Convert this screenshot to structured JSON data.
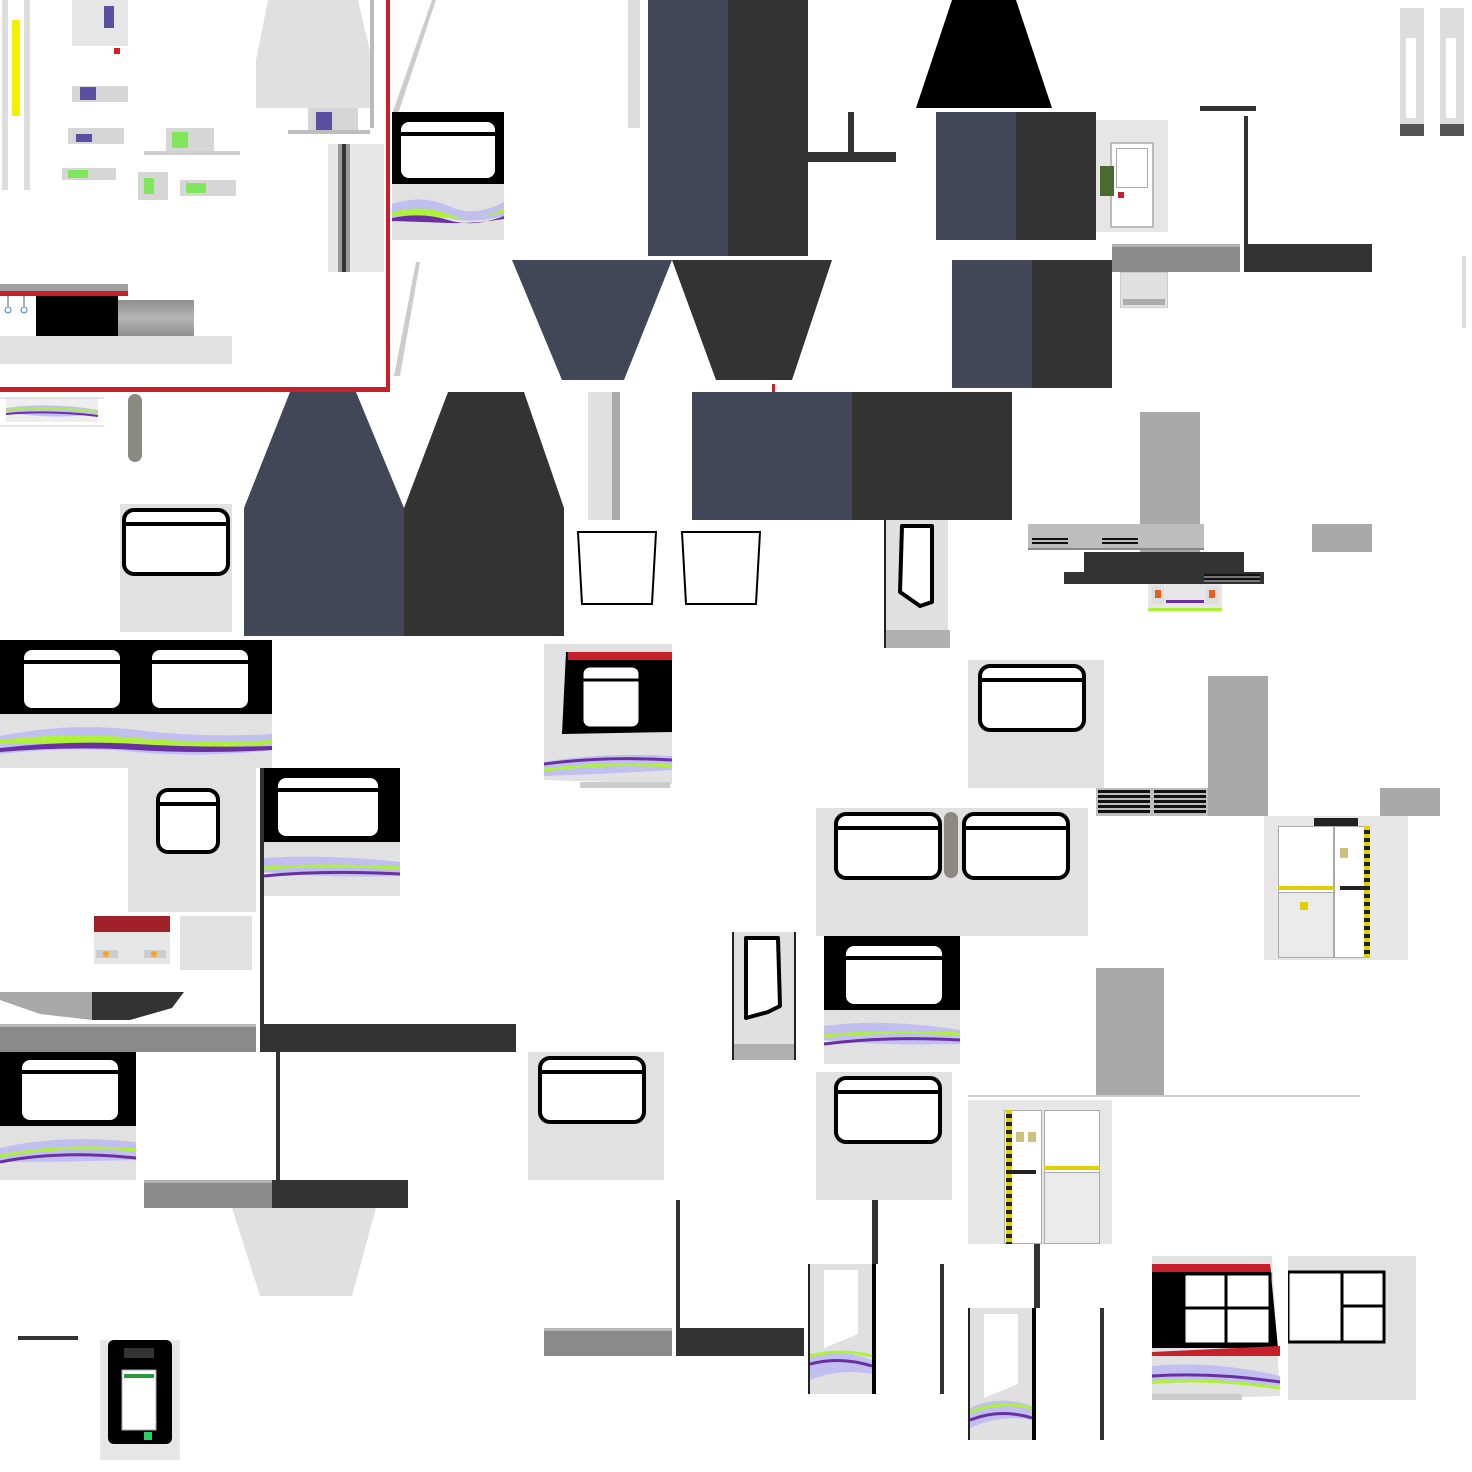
{
  "texture_atlas": {
    "colors": {
      "navy": "#414756",
      "dark": "#333333",
      "light_panel": "#e1e1e1",
      "concrete": "#a9a9a9",
      "accent_red": "#c8202a",
      "livery_purple": "#6a2fa0",
      "livery_lime": "#aef03a",
      "livery_lavender": "#c0bff0",
      "hazard_yellow": "#e0d000"
    },
    "icons": [
      "strap-handle-icon",
      "stop-button-icon",
      "warning-sign-icon",
      "ticket-validator-icon"
    ]
  }
}
